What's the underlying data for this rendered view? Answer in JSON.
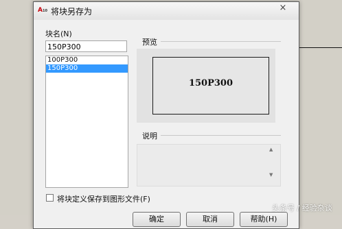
{
  "dialog": {
    "title": "将块另存为",
    "close_icon": "×",
    "app_icon_text": "A",
    "app_icon_sub": "10"
  },
  "block_name": {
    "label": "块名(N)",
    "value": "150P300"
  },
  "block_list": {
    "items": [
      {
        "label": "100P300",
        "selected": false
      },
      {
        "label": "150P300",
        "selected": true
      }
    ]
  },
  "preview": {
    "label": "预览",
    "text": "150P300"
  },
  "description": {
    "label": "说明",
    "scroll_up_icon": "▲",
    "scroll_down_icon": "▼"
  },
  "save_checkbox": {
    "label": "将块定义保存到图形文件(F)",
    "checked": false
  },
  "buttons": {
    "save": "确定",
    "cancel": "取消",
    "help": "帮助(H)"
  },
  "watermark": "头条号 / 经验杂谈"
}
